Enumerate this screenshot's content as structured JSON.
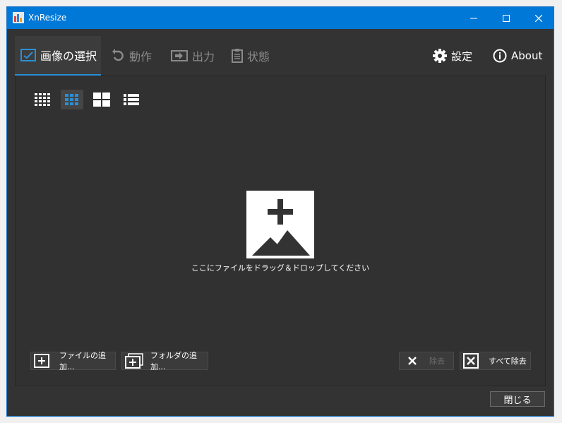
{
  "window": {
    "title": "XnResize",
    "controls": [
      "minimize-icon",
      "maximize-icon",
      "close-icon"
    ]
  },
  "tabs": [
    {
      "label": "画像の選択",
      "icon": "image-select-icon",
      "active": true
    },
    {
      "label": "動作",
      "icon": "rotate-icon",
      "active": false
    },
    {
      "label": "出力",
      "icon": "export-icon",
      "active": false
    },
    {
      "label": "状態",
      "icon": "clipboard-icon",
      "active": false
    }
  ],
  "right_tabs": {
    "settings_label": "設定",
    "about_label": "About"
  },
  "view_modes": [
    {
      "icon": "small-grid-icon",
      "selected": false
    },
    {
      "icon": "medium-grid-icon",
      "selected": true
    },
    {
      "icon": "large-grid-icon",
      "selected": false
    },
    {
      "icon": "list-view-icon",
      "selected": false
    }
  ],
  "drop_area": {
    "icon": "add-image-icon",
    "text": "ここにファイルをドラッグ＆ドロップしてください"
  },
  "buttons": {
    "add_files": "ファイルの追加...",
    "add_folder": "フォルダの追加...",
    "remove": "除去",
    "remove_all": "すべて除去",
    "close": "閉じる"
  },
  "colors": {
    "titlebar": "#0078d7",
    "background": "#333333",
    "accent": "#2b8fd6"
  }
}
